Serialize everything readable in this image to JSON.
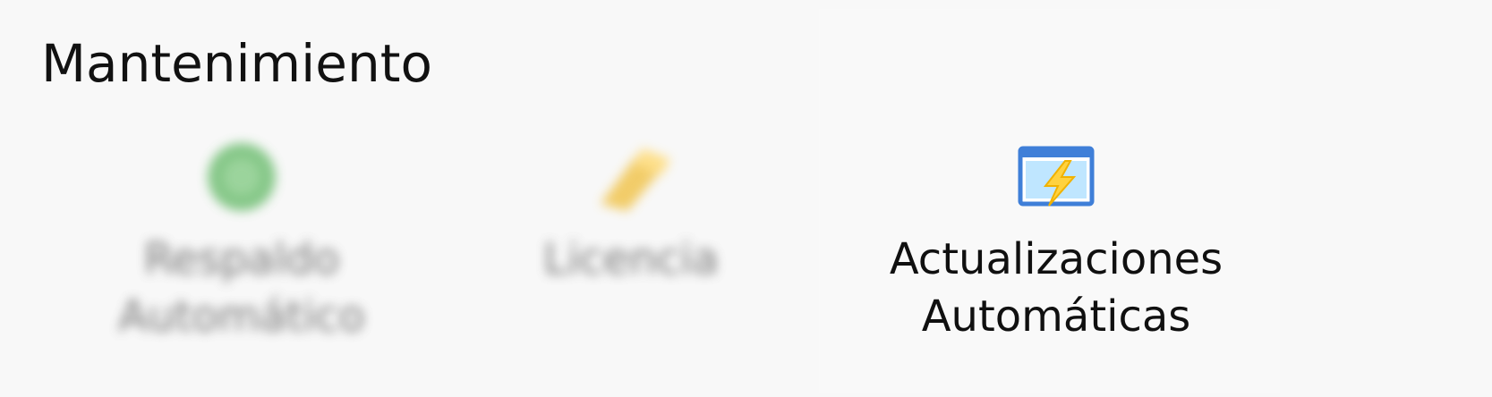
{
  "group": {
    "title": "Mantenimiento"
  },
  "buttons": [
    {
      "label": "Respaldo\nAutomático",
      "icon": "backup-icon",
      "icon_color": "#4caf50"
    },
    {
      "label": "Licencia",
      "icon": "license-key-icon",
      "icon_color": "#f0c040"
    },
    {
      "label": "Actualizaciones\nAutomáticas",
      "icon": "auto-update-icon",
      "icon_color": "#3f7fd8"
    }
  ]
}
